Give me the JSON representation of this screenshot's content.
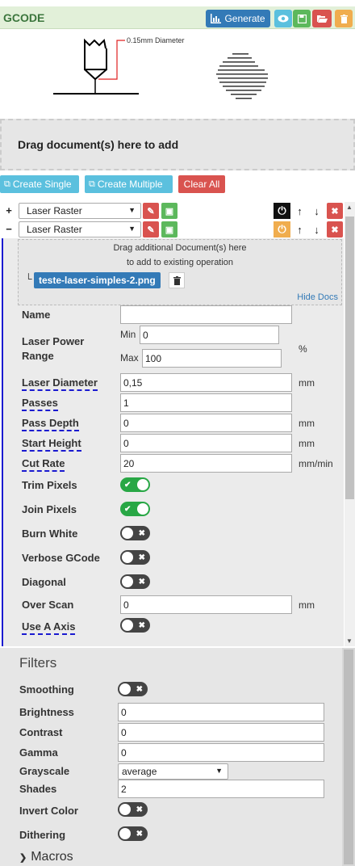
{
  "header": {
    "title": "GCODE",
    "generate_label": "Generate"
  },
  "illustration": {
    "diameter_label": "0.15mm Diameter"
  },
  "drop_zone": {
    "text": "Drag document(s) here to add"
  },
  "toolbar": {
    "create_single": "Create Single",
    "create_multiple": "Create Multiple",
    "clear_all": "Clear All"
  },
  "operations": [
    {
      "type": "Laser Raster",
      "expand_symbol": "+"
    },
    {
      "type": "Laser Raster",
      "expand_symbol": "−"
    }
  ],
  "doc_drop": {
    "line1": "Drag additional Document(s) here",
    "line2": "to add to existing operation",
    "doc_name": "teste-laser-simples-2.png",
    "hide_docs": "Hide Docs",
    "tree_char": "└"
  },
  "fields": {
    "name_label": "Name",
    "name_value": "",
    "power_label_1": "Laser Power",
    "power_label_2": "Range",
    "min_label": "Min",
    "min_value": "0",
    "max_label": "Max",
    "max_value": "100",
    "power_unit": "%",
    "diameter_label": "Laser Diameter",
    "diameter_value": "0,15",
    "diameter_unit": "mm",
    "passes_label": "Passes",
    "passes_value": "1",
    "pass_depth_label": "Pass Depth",
    "pass_depth_value": "0",
    "pass_depth_unit": "mm",
    "start_height_label": "Start Height",
    "start_height_value": "0",
    "start_height_unit": "mm",
    "cut_rate_label": "Cut Rate",
    "cut_rate_value": "20",
    "cut_rate_unit": "mm/min",
    "trim_pixels_label": "Trim Pixels",
    "join_pixels_label": "Join Pixels",
    "burn_white_label": "Burn White",
    "verbose_gcode_label": "Verbose GCode",
    "diagonal_label": "Diagonal",
    "over_scan_label": "Over Scan",
    "over_scan_value": "0",
    "over_scan_unit": "mm",
    "use_a_axis_label": "Use A Axis"
  },
  "toggles": {
    "trim_pixels": true,
    "join_pixels": true,
    "burn_white": false,
    "verbose_gcode": false,
    "diagonal": false,
    "use_a_axis": false,
    "smoothing": false,
    "invert_color": false,
    "dithering": false
  },
  "filters": {
    "title": "Filters",
    "smoothing_label": "Smoothing",
    "brightness_label": "Brightness",
    "brightness_value": "0",
    "contrast_label": "Contrast",
    "contrast_value": "0",
    "gamma_label": "Gamma",
    "gamma_value": "0",
    "grayscale_label": "Grayscale",
    "grayscale_value": "average",
    "shades_label": "Shades",
    "shades_value": "2",
    "invert_color_label": "Invert Color",
    "dithering_label": "Dithering",
    "macros_label": "Macros"
  },
  "colors": {
    "header_bg": "#e2f0d9",
    "header_text": "#3c763d",
    "primary": "#337ab7",
    "info": "#5bc0de",
    "success": "#5cb85c",
    "danger": "#d9534f",
    "warning": "#f0ad4e",
    "toggle_on": "#28a745"
  }
}
